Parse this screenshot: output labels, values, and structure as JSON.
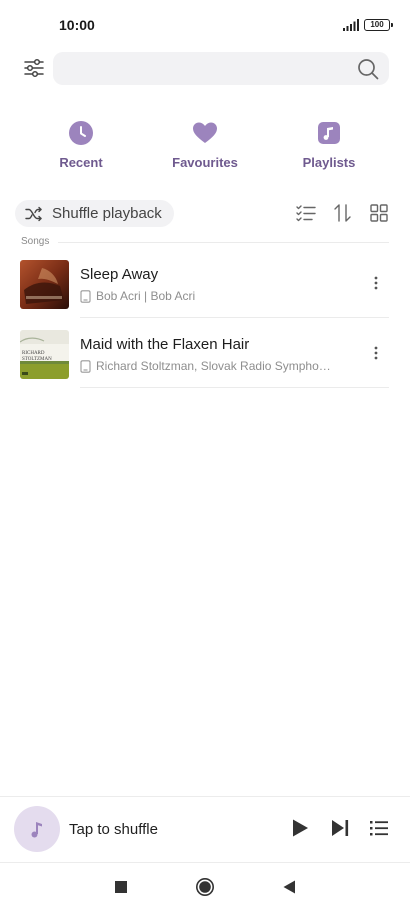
{
  "status_bar": {
    "time": "10:00",
    "battery": "100",
    "icons": [
      "signal-icon",
      "battery-icon"
    ]
  },
  "search": {
    "value": "",
    "placeholder": "",
    "icons": [
      "filter-icon",
      "search-icon"
    ]
  },
  "categories": [
    {
      "label": "Recent",
      "icon": "clock-icon"
    },
    {
      "label": "Favourites",
      "icon": "heart-icon"
    },
    {
      "label": "Playlists",
      "icon": "music-note-icon"
    }
  ],
  "controls": {
    "shuffle_label": "Shuffle playback",
    "icons": [
      "shuffle-icon",
      "multi-select-icon",
      "sort-icon",
      "grid-view-icon"
    ]
  },
  "section": {
    "label": "Songs"
  },
  "songs": [
    {
      "title": "Sleep Away",
      "subtitle": "Bob Acri | Bob Acri",
      "art": "album-art-sleep-away"
    },
    {
      "title": "Maid with the Flaxen Hair",
      "subtitle": "Richard Stoltzman, Slovak Radio Sympho…",
      "art": "album-art-richard-stoltzman",
      "art_text": [
        "RICHARD",
        "STOLTZMAN"
      ]
    }
  ],
  "player": {
    "text": "Tap to shuffle",
    "icons": [
      "music-note-icon",
      "play-icon",
      "skip-next-icon",
      "queue-icon"
    ]
  },
  "navbar": {
    "icons": [
      "recents-square-icon",
      "home-circle-icon",
      "back-triangle-icon"
    ]
  },
  "colors": {
    "accent": "#9c84bd",
    "accent_text": "#6f5a8f",
    "chip_bg": "#f2f2f4",
    "divider": "#ebebeb"
  }
}
